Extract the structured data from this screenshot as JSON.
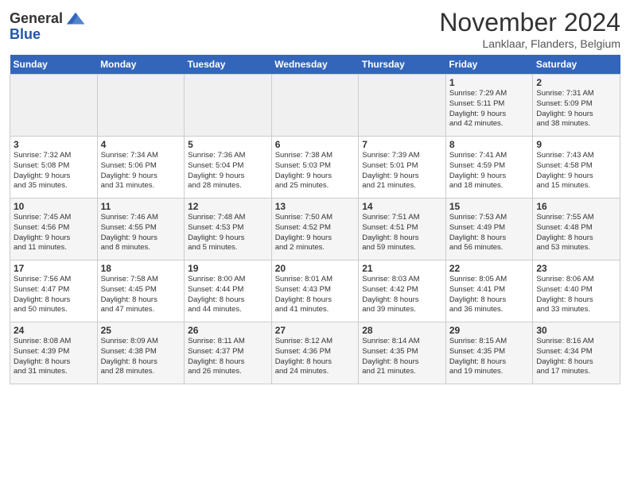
{
  "header": {
    "logo_general": "General",
    "logo_blue": "Blue",
    "month_title": "November 2024",
    "location": "Lanklaar, Flanders, Belgium"
  },
  "days_of_week": [
    "Sunday",
    "Monday",
    "Tuesday",
    "Wednesday",
    "Thursday",
    "Friday",
    "Saturday"
  ],
  "weeks": [
    [
      {
        "day": "",
        "info": ""
      },
      {
        "day": "",
        "info": ""
      },
      {
        "day": "",
        "info": ""
      },
      {
        "day": "",
        "info": ""
      },
      {
        "day": "",
        "info": ""
      },
      {
        "day": "1",
        "info": "Sunrise: 7:29 AM\nSunset: 5:11 PM\nDaylight: 9 hours\nand 42 minutes."
      },
      {
        "day": "2",
        "info": "Sunrise: 7:31 AM\nSunset: 5:09 PM\nDaylight: 9 hours\nand 38 minutes."
      }
    ],
    [
      {
        "day": "3",
        "info": "Sunrise: 7:32 AM\nSunset: 5:08 PM\nDaylight: 9 hours\nand 35 minutes."
      },
      {
        "day": "4",
        "info": "Sunrise: 7:34 AM\nSunset: 5:06 PM\nDaylight: 9 hours\nand 31 minutes."
      },
      {
        "day": "5",
        "info": "Sunrise: 7:36 AM\nSunset: 5:04 PM\nDaylight: 9 hours\nand 28 minutes."
      },
      {
        "day": "6",
        "info": "Sunrise: 7:38 AM\nSunset: 5:03 PM\nDaylight: 9 hours\nand 25 minutes."
      },
      {
        "day": "7",
        "info": "Sunrise: 7:39 AM\nSunset: 5:01 PM\nDaylight: 9 hours\nand 21 minutes."
      },
      {
        "day": "8",
        "info": "Sunrise: 7:41 AM\nSunset: 4:59 PM\nDaylight: 9 hours\nand 18 minutes."
      },
      {
        "day": "9",
        "info": "Sunrise: 7:43 AM\nSunset: 4:58 PM\nDaylight: 9 hours\nand 15 minutes."
      }
    ],
    [
      {
        "day": "10",
        "info": "Sunrise: 7:45 AM\nSunset: 4:56 PM\nDaylight: 9 hours\nand 11 minutes."
      },
      {
        "day": "11",
        "info": "Sunrise: 7:46 AM\nSunset: 4:55 PM\nDaylight: 9 hours\nand 8 minutes."
      },
      {
        "day": "12",
        "info": "Sunrise: 7:48 AM\nSunset: 4:53 PM\nDaylight: 9 hours\nand 5 minutes."
      },
      {
        "day": "13",
        "info": "Sunrise: 7:50 AM\nSunset: 4:52 PM\nDaylight: 9 hours\nand 2 minutes."
      },
      {
        "day": "14",
        "info": "Sunrise: 7:51 AM\nSunset: 4:51 PM\nDaylight: 8 hours\nand 59 minutes."
      },
      {
        "day": "15",
        "info": "Sunrise: 7:53 AM\nSunset: 4:49 PM\nDaylight: 8 hours\nand 56 minutes."
      },
      {
        "day": "16",
        "info": "Sunrise: 7:55 AM\nSunset: 4:48 PM\nDaylight: 8 hours\nand 53 minutes."
      }
    ],
    [
      {
        "day": "17",
        "info": "Sunrise: 7:56 AM\nSunset: 4:47 PM\nDaylight: 8 hours\nand 50 minutes."
      },
      {
        "day": "18",
        "info": "Sunrise: 7:58 AM\nSunset: 4:45 PM\nDaylight: 8 hours\nand 47 minutes."
      },
      {
        "day": "19",
        "info": "Sunrise: 8:00 AM\nSunset: 4:44 PM\nDaylight: 8 hours\nand 44 minutes."
      },
      {
        "day": "20",
        "info": "Sunrise: 8:01 AM\nSunset: 4:43 PM\nDaylight: 8 hours\nand 41 minutes."
      },
      {
        "day": "21",
        "info": "Sunrise: 8:03 AM\nSunset: 4:42 PM\nDaylight: 8 hours\nand 39 minutes."
      },
      {
        "day": "22",
        "info": "Sunrise: 8:05 AM\nSunset: 4:41 PM\nDaylight: 8 hours\nand 36 minutes."
      },
      {
        "day": "23",
        "info": "Sunrise: 8:06 AM\nSunset: 4:40 PM\nDaylight: 8 hours\nand 33 minutes."
      }
    ],
    [
      {
        "day": "24",
        "info": "Sunrise: 8:08 AM\nSunset: 4:39 PM\nDaylight: 8 hours\nand 31 minutes."
      },
      {
        "day": "25",
        "info": "Sunrise: 8:09 AM\nSunset: 4:38 PM\nDaylight: 8 hours\nand 28 minutes."
      },
      {
        "day": "26",
        "info": "Sunrise: 8:11 AM\nSunset: 4:37 PM\nDaylight: 8 hours\nand 26 minutes."
      },
      {
        "day": "27",
        "info": "Sunrise: 8:12 AM\nSunset: 4:36 PM\nDaylight: 8 hours\nand 24 minutes."
      },
      {
        "day": "28",
        "info": "Sunrise: 8:14 AM\nSunset: 4:35 PM\nDaylight: 8 hours\nand 21 minutes."
      },
      {
        "day": "29",
        "info": "Sunrise: 8:15 AM\nSunset: 4:35 PM\nDaylight: 8 hours\nand 19 minutes."
      },
      {
        "day": "30",
        "info": "Sunrise: 8:16 AM\nSunset: 4:34 PM\nDaylight: 8 hours\nand 17 minutes."
      }
    ]
  ]
}
